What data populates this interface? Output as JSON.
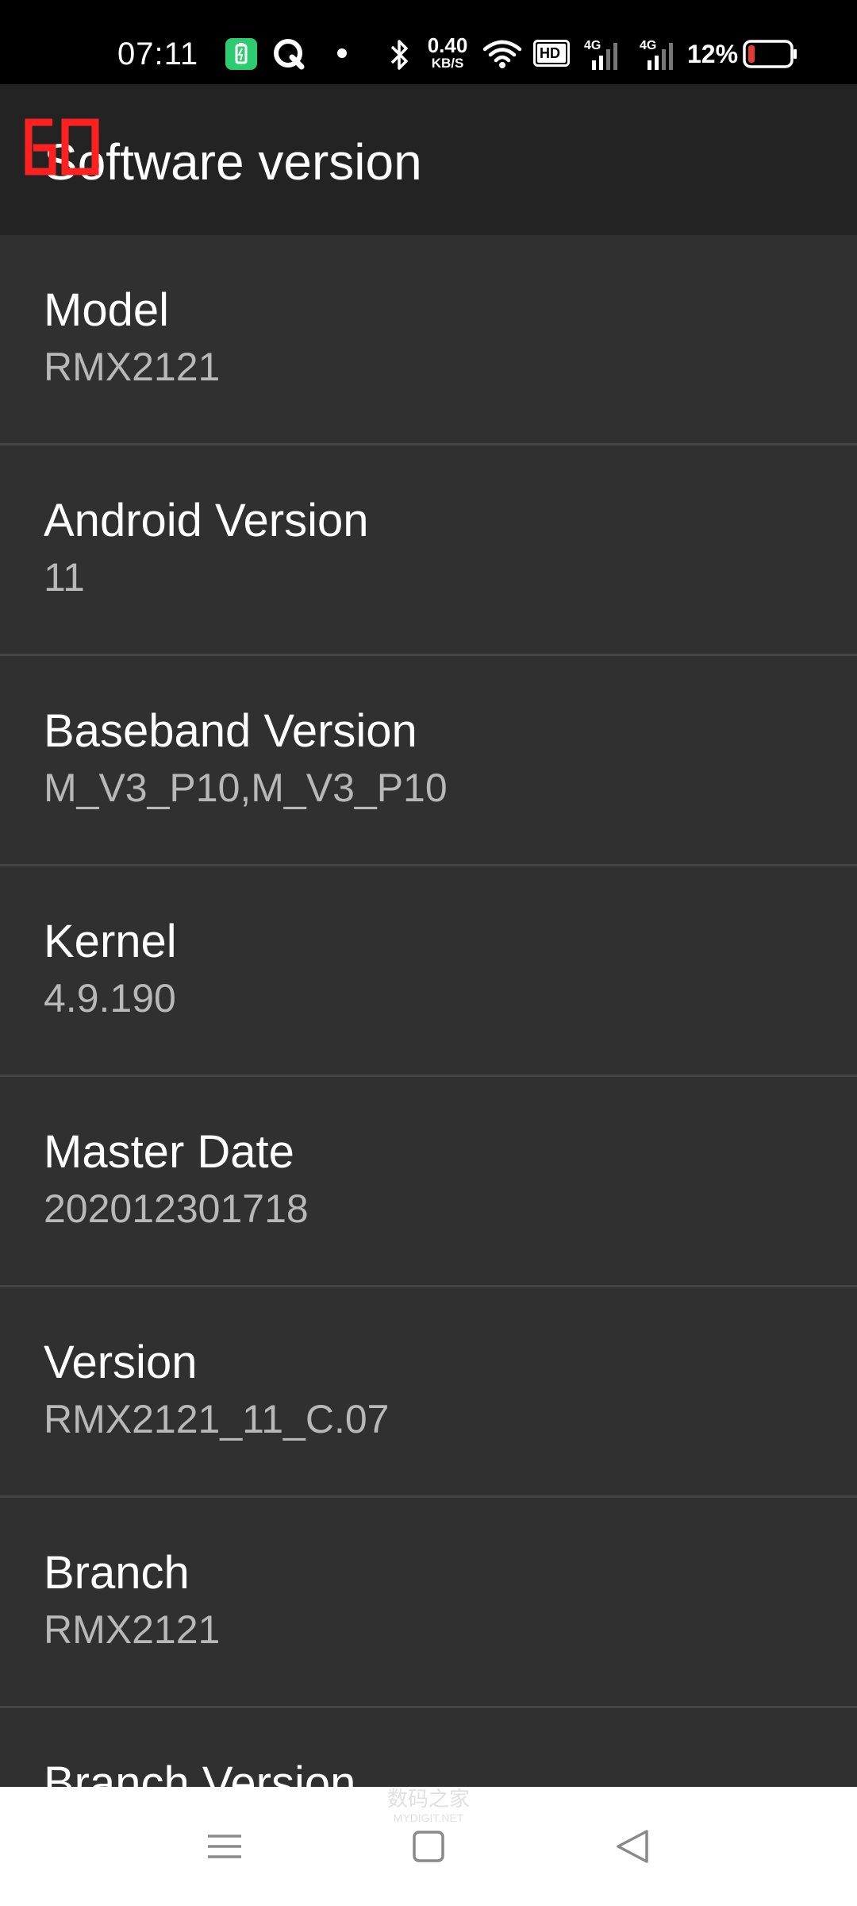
{
  "status_bar": {
    "time": "07:11",
    "net_speed_value": "0.40",
    "net_speed_unit": "KB/S",
    "sim1_type": "4G",
    "sim2_type": "4G",
    "hd_label": "HD",
    "battery_percent": "12%",
    "icons": [
      "battery-saver-icon",
      "q-app-icon",
      "dot-icon",
      "bluetooth-icon",
      "wifi-icon",
      "hd-voice-icon",
      "signal-icon",
      "signal-icon",
      "battery-icon"
    ],
    "battery_level": 0.12,
    "battery_color": "#e53935",
    "battery_saver_color": "#2ecc71"
  },
  "app_bar": {
    "title": "Software version",
    "fps_overlay": "60",
    "fps_color": "#ff2020"
  },
  "rows": [
    {
      "label": "Model",
      "value": "RMX2121"
    },
    {
      "label": "Android Version",
      "value": "11"
    },
    {
      "label": "Baseband Version",
      "value": "M_V3_P10,M_V3_P10"
    },
    {
      "label": "Kernel",
      "value": "4.9.190"
    },
    {
      "label": "Master Date",
      "value": "202012301718"
    },
    {
      "label": "Version",
      "value": "RMX2121_11_C.07"
    },
    {
      "label": "Branch",
      "value": "RMX2121"
    }
  ],
  "partial_row": {
    "label": "Branch Version"
  },
  "nav_bar": {
    "buttons": [
      "menu-icon",
      "home-icon",
      "back-icon"
    ]
  },
  "watermark": {
    "text": "数码之家",
    "subtext": "MYDIGIT.NET"
  }
}
